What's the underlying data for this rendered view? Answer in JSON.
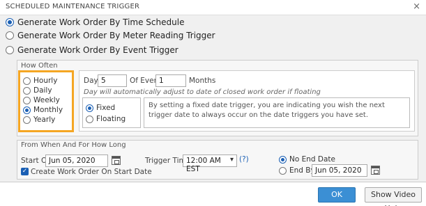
{
  "window": {
    "title": "SCHEDULED MAINTENANCE TRIGGER",
    "close_glyph": "×"
  },
  "triggers": [
    {
      "label": "Generate Work Order By Time Schedule",
      "selected": true
    },
    {
      "label": "Generate Work Order By Meter Reading Trigger",
      "selected": false
    },
    {
      "label": "Generate Work Order By Event Trigger",
      "selected": false
    }
  ],
  "how_often": {
    "title": "How Often",
    "options": [
      {
        "label": "Hourly",
        "selected": false
      },
      {
        "label": "Daily",
        "selected": false
      },
      {
        "label": "Weekly",
        "selected": false
      },
      {
        "label": "Monthly",
        "selected": true
      },
      {
        "label": "Yearly",
        "selected": false
      }
    ],
    "day_label": "Day",
    "day_value": "5",
    "of_every_label": "Of Every",
    "of_every_value": "1",
    "months_label": "Months",
    "note": "Day will automatically adjust to date of closed work order if floating",
    "date_mode": [
      {
        "label": "Fixed",
        "selected": true
      },
      {
        "label": "Floating",
        "selected": false
      }
    ],
    "fixed_description": "By setting a fixed date trigger, you are indicating you wish the next trigger date to always occur on the date triggers you have set."
  },
  "when": {
    "title": "From When And For How Long",
    "start_on_label": "Start On",
    "start_on_value": "Jun 05, 2020",
    "create_on_start_label": "Create Work Order On Start Date",
    "create_on_start_checked": true,
    "trigger_time_label": "Trigger Time",
    "trigger_time_value": "12:00 AM EST",
    "help_label": "(?)",
    "end_options": [
      {
        "label": "No End Date",
        "selected": true
      },
      {
        "label": "End By",
        "selected": false
      }
    ],
    "end_by_value": "Jun 05, 2020"
  },
  "buttons": {
    "ok": "OK",
    "video": "Show Video Help"
  },
  "colors": {
    "highlight": "#f5a623",
    "accent": "#1a5fb4",
    "ok_button": "#3b8fd4"
  }
}
